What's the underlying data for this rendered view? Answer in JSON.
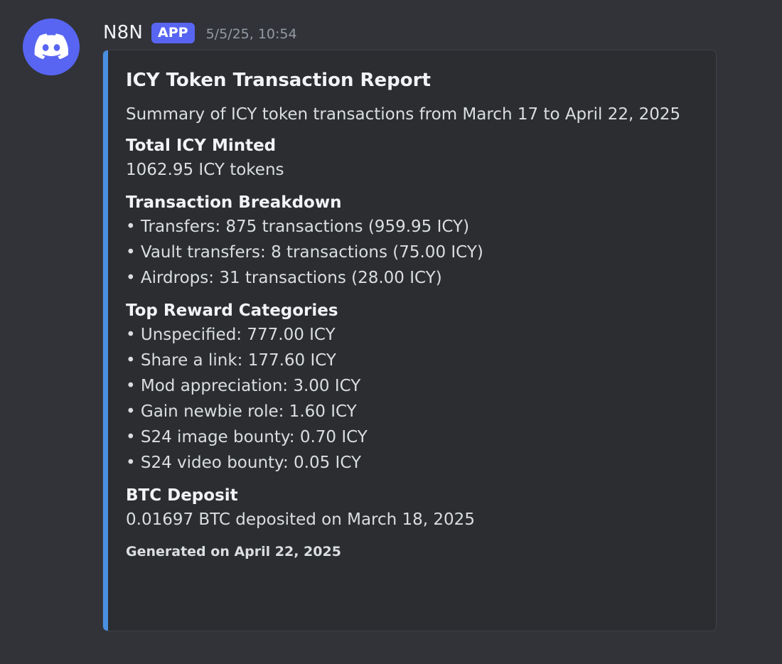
{
  "message": {
    "username": "N8N",
    "badge": "APP",
    "timestamp": "5/5/25, 10:54",
    "avatar_icon": "discord-logo-icon",
    "colors": {
      "background": "#313338",
      "embed_background": "#2b2d31",
      "embed_accent": "#4a90e2",
      "badge": "#5865f2"
    }
  },
  "embed": {
    "title": "ICY Token Transaction Report",
    "description": "Summary of ICY token transactions from March 17 to April 22, 2025",
    "fields": [
      {
        "name": "Total ICY Minted",
        "lines": [
          "1062.95 ICY tokens"
        ]
      },
      {
        "name": "Transaction Breakdown",
        "lines": [
          "• Transfers: 875 transactions (959.95 ICY)",
          "• Vault transfers: 8 transactions (75.00 ICY)",
          "• Airdrops: 31 transactions (28.00 ICY)"
        ]
      },
      {
        "name": "Top Reward Categories",
        "lines": [
          "• Unspecified: 777.00 ICY",
          "• Share a link: 177.60 ICY",
          "• Mod appreciation: 3.00 ICY",
          "• Gain newbie role: 1.60 ICY",
          "• S24 image bounty: 0.70 ICY",
          "• S24 video bounty: 0.05 ICY"
        ]
      },
      {
        "name": "BTC Deposit",
        "lines": [
          "0.01697 BTC deposited on March 18, 2025"
        ]
      }
    ],
    "footer": "Generated on April 22, 2025"
  }
}
